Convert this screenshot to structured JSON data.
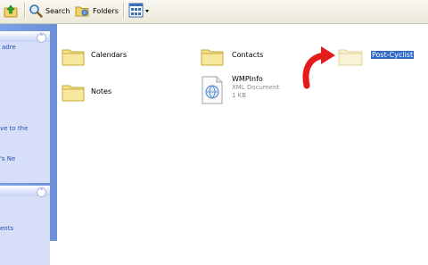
{
  "toolbar": {
    "search_label": "Search",
    "folders_label": "Folders"
  },
  "taskpane": {
    "lines": [
      "adre",
      "ve to the",
      "'s Ne",
      "ents"
    ]
  },
  "items": {
    "calendars": "Calendars",
    "contacts": "Contacts",
    "new_folder": "Post-Cyclist",
    "notes": "Notes",
    "wmpinfo_name": "WMPInfo",
    "wmpinfo_type": "XML Document",
    "wmpinfo_size": "1 KB"
  },
  "colors": {
    "arrow": "#e31b1b",
    "selection": "#316ac5",
    "taskpane": "#7aa1e6"
  }
}
